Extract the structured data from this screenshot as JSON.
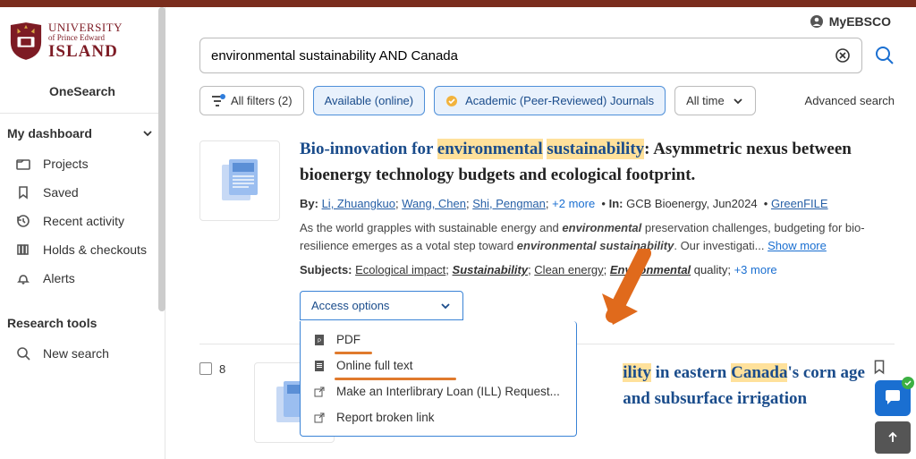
{
  "header": {
    "myebsco": "MyEBSCO",
    "advanced_search": "Advanced search"
  },
  "logo": {
    "line1": "UNIVERSITY",
    "line2": "of Prince Edward",
    "line3": "ISLAND"
  },
  "sidebar": {
    "onesearch": "OneSearch",
    "dashboard": "My dashboard",
    "items": [
      {
        "label": "Projects"
      },
      {
        "label": "Saved"
      },
      {
        "label": "Recent activity"
      },
      {
        "label": "Holds & checkouts"
      },
      {
        "label": "Alerts"
      }
    ],
    "tools_header": "Research tools",
    "tools": [
      {
        "label": "New search"
      }
    ]
  },
  "search": {
    "value": "environmental sustainability AND Canada"
  },
  "filters": {
    "all_filters": "All filters (2)",
    "available": "Available (online)",
    "peer": "Academic (Peer-Reviewed) Journals",
    "all_time": "All time"
  },
  "result1": {
    "title_pre": "Bio-innovation for ",
    "title_hl1": "environmental",
    "title_hl2": "sustainability",
    "title_post": ": Asymmetric nexus between bioenergy technology budgets and ecological footprint.",
    "by_label": "By:",
    "authors": [
      "Li, Zhuangkuo",
      "Wang, Chen",
      "Shi, Pengman"
    ],
    "more_authors": "+2 more",
    "in_label": "In:",
    "in_value": "GCB Bioenergy, Jun2024",
    "source": "GreenFILE",
    "snippet_a": "As the world grapples with sustainable energy and ",
    "snippet_em1": "environmental",
    "snippet_b": " preservation challenges, budgeting for bio-resilience emerges as a ",
    "snippet_c": "votal step toward ",
    "snippet_em2": "environmental sustainability",
    "snippet_d": ". Our investigati... ",
    "show_more": "Show more",
    "subjects_label": "Subjects:",
    "subjects": [
      {
        "text": "Ecological impact",
        "em": false
      },
      {
        "text": "Sustainability",
        "em": true
      },
      {
        "text": "Clean energy",
        "em": false
      },
      {
        "text": "Environmental",
        "em": true,
        "suffix": " quality"
      }
    ],
    "subjects_more": "+3 more",
    "access_label": "Access options",
    "access_menu": [
      "PDF",
      "Online full text",
      "Make an Interlibrary Loan (ILL) Request...",
      "Report broken link"
    ]
  },
  "result2": {
    "index": "8",
    "t_hl1": "ility",
    "t_mid1": " in eastern ",
    "t_hl2": "Canada",
    "t_end": "'s corn age and subsurface irrigation"
  }
}
